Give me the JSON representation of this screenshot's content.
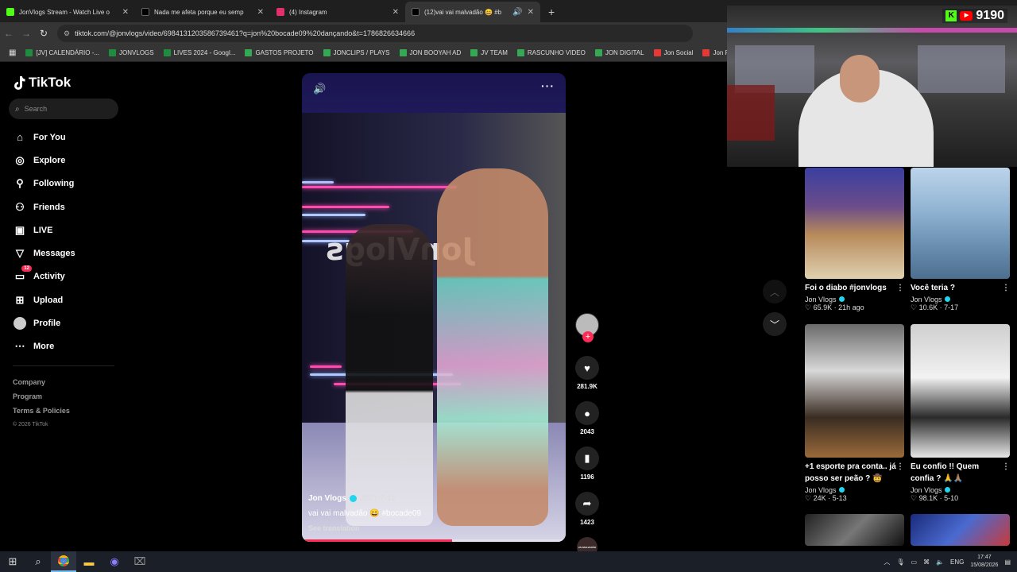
{
  "browser": {
    "tabs": [
      {
        "title": "JonVlogs Stream - Watch Live o",
        "color": "#53fc18"
      },
      {
        "title": "Nada me afeta porque eu semp",
        "color": "#ffffff"
      },
      {
        "title": "(4) Instagram",
        "color": "#e1306c"
      },
      {
        "title": "(12)vai vai malvadão 😄 #b",
        "color": "#ffffff"
      }
    ],
    "new_tab": "+",
    "url": "tiktok.com/@jonvlogs/video/6984131203586739461?q=jon%20bocade09%20dançando&t=1786826634666",
    "bookmarks": [
      {
        "label": "[JV] CALENDÁRIO -...",
        "color": "#1e8e3e"
      },
      {
        "label": "JONVLOGS",
        "color": "#1e8e3e"
      },
      {
        "label": "LIVES 2024 - Googl...",
        "color": "#1e8e3e"
      },
      {
        "label": "GASTOS PROJETO",
        "color": "#34a853"
      },
      {
        "label": "JONCLIPS / PLAYS",
        "color": "#34a853"
      },
      {
        "label": "JON BOOYAH AD",
        "color": "#34a853"
      },
      {
        "label": "JV TEAM",
        "color": "#34a853"
      },
      {
        "label": "RASCUNHO VIDEO",
        "color": "#34a853"
      },
      {
        "label": "JON DIGITAL",
        "color": "#34a853"
      },
      {
        "label": "Jon Social",
        "color": "#e53935"
      },
      {
        "label": "Jon Plays",
        "color": "#e53935"
      }
    ]
  },
  "tiktok": {
    "logo": "TikTok",
    "search_placeholder": "Search",
    "nav": [
      {
        "label": "For You",
        "icon": "home-icon"
      },
      {
        "label": "Explore",
        "icon": "compass-icon"
      },
      {
        "label": "Following",
        "icon": "person-icon"
      },
      {
        "label": "Friends",
        "icon": "friends-icon"
      },
      {
        "label": "LIVE",
        "icon": "live-icon"
      },
      {
        "label": "Messages",
        "icon": "messages-icon"
      },
      {
        "label": "Activity",
        "icon": "activity-icon",
        "badge": "12"
      },
      {
        "label": "Upload",
        "icon": "upload-icon"
      },
      {
        "label": "Profile",
        "icon": "avatar-icon"
      },
      {
        "label": "More",
        "icon": "more-icon"
      }
    ],
    "footer": {
      "company": "Company",
      "program": "Program",
      "terms": "Terms & Policies",
      "copyright": "© 2026 TikTok"
    }
  },
  "video": {
    "author": "Jon Vlogs",
    "date": "2021-7-12",
    "caption": "vai vai malvadão 😄 #bocade09",
    "translate": "See translation",
    "progress_percent": 57,
    "sign_text": "JonVlogs",
    "music_label": "VAI MALVADÃO"
  },
  "actions": {
    "likes": "281.9K",
    "comments": "2043",
    "saves": "1196",
    "shares": "1423"
  },
  "stream": {
    "viewers": "9190"
  },
  "related": [
    {
      "title": "Foi o diabo #jonvlogs",
      "user": "Jon Vlogs",
      "stats": "♡ 65.9K · 21h ago",
      "bg": "linear-gradient(180deg,#3a3fa0 0%,#6b4c8a 35%,#b78a5a 60%,#e0d0b0 100%)"
    },
    {
      "title": "Você teria ?",
      "user": "Jon Vlogs",
      "stats": "♡ 10.6K · 7-17",
      "bg": "linear-gradient(180deg,#bcd4ea 0%,#8fb2d2 40%,#6a8fb0 70%,#4d6f8f 100%)"
    },
    {
      "title": "+1 esporte pra conta.. já posso ser peão ? 🤠",
      "user": "Jon Vlogs",
      "stats": "♡ 24K · 5-13",
      "bg": "linear-gradient(180deg,#6a6a6a 0%,#d8d8d8 35%,#3a2c22 70%,#9a6a3a 100%)"
    },
    {
      "title": "Eu confio !! Quem confia ? 🙏🙏🏽",
      "user": "Jon Vlogs",
      "stats": "♡ 98.1K · 5-10",
      "bg": "linear-gradient(180deg,#cfcfcf 0%,#f2f2f2 40%,#2a2a2a 70%,#e8e8e8 100%)"
    }
  ],
  "taskbar": {
    "lang": "ENG",
    "time": "17:47",
    "date": "15/08/2026"
  }
}
